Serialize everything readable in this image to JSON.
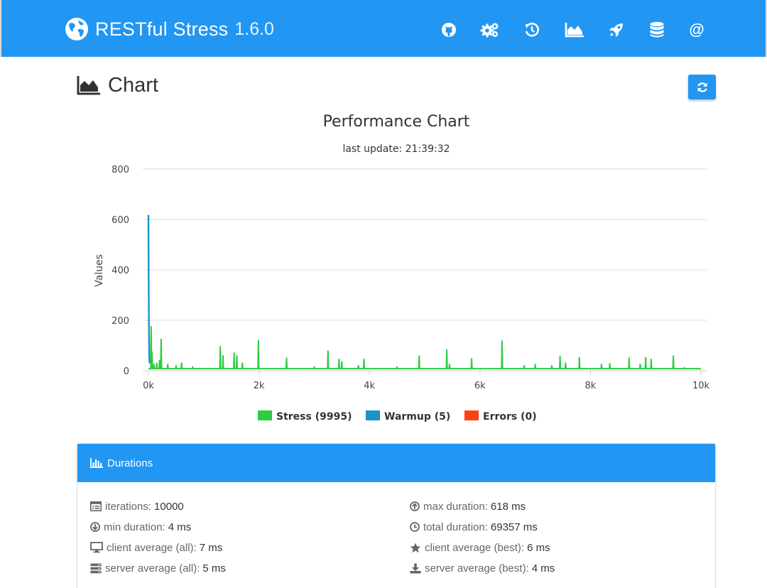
{
  "app": {
    "name": "RESTful Stress",
    "version": "1.6.0"
  },
  "nav": {
    "items": [
      {
        "name": "nav-github",
        "icon": "github-icon"
      },
      {
        "name": "nav-settings",
        "icon": "cogs-icon"
      },
      {
        "name": "nav-history",
        "icon": "history-icon"
      },
      {
        "name": "nav-chart",
        "icon": "area-chart-icon"
      },
      {
        "name": "nav-launch",
        "icon": "rocket-icon"
      },
      {
        "name": "nav-database",
        "icon": "database-icon"
      },
      {
        "name": "nav-contact",
        "icon": "at-icon",
        "text": "@"
      }
    ]
  },
  "page": {
    "title": "Chart",
    "refresh_icon": "refresh-icon"
  },
  "chart_data": {
    "type": "line",
    "title": "Performance Chart",
    "subtitle": "last update: 21:39:32",
    "ylabel": "Values",
    "xlabel": "",
    "xlim": [
      0,
      10000
    ],
    "ylim": [
      0,
      800
    ],
    "x_ticks": [
      "0k",
      "2k",
      "4k",
      "6k",
      "8k",
      "10k"
    ],
    "y_ticks": [
      "0",
      "200",
      "400",
      "600",
      "800"
    ],
    "grid": true,
    "legend_position": "bottom",
    "series": [
      {
        "name": "Stress (9995)",
        "color": "#2ecc40",
        "baseline": 8,
        "spikes": [
          {
            "x": 50,
            "y": 175
          },
          {
            "x": 65,
            "y": 75
          },
          {
            "x": 100,
            "y": 25
          },
          {
            "x": 150,
            "y": 30
          },
          {
            "x": 200,
            "y": 40
          },
          {
            "x": 230,
            "y": 125
          },
          {
            "x": 350,
            "y": 25
          },
          {
            "x": 500,
            "y": 20
          },
          {
            "x": 600,
            "y": 30
          },
          {
            "x": 800,
            "y": 15
          },
          {
            "x": 1300,
            "y": 95
          },
          {
            "x": 1350,
            "y": 60
          },
          {
            "x": 1550,
            "y": 70
          },
          {
            "x": 1600,
            "y": 60
          },
          {
            "x": 1700,
            "y": 30
          },
          {
            "x": 1990,
            "y": 120
          },
          {
            "x": 2500,
            "y": 50
          },
          {
            "x": 3000,
            "y": 15
          },
          {
            "x": 3250,
            "y": 78
          },
          {
            "x": 3450,
            "y": 45
          },
          {
            "x": 3500,
            "y": 35
          },
          {
            "x": 3800,
            "y": 20
          },
          {
            "x": 3900,
            "y": 45
          },
          {
            "x": 4500,
            "y": 15
          },
          {
            "x": 4900,
            "y": 58
          },
          {
            "x": 5400,
            "y": 82
          },
          {
            "x": 5450,
            "y": 25
          },
          {
            "x": 5850,
            "y": 47
          },
          {
            "x": 6400,
            "y": 118
          },
          {
            "x": 6800,
            "y": 20
          },
          {
            "x": 7000,
            "y": 25
          },
          {
            "x": 7300,
            "y": 20
          },
          {
            "x": 7450,
            "y": 57
          },
          {
            "x": 7550,
            "y": 30
          },
          {
            "x": 7800,
            "y": 52
          },
          {
            "x": 8200,
            "y": 25
          },
          {
            "x": 8350,
            "y": 28
          },
          {
            "x": 8700,
            "y": 50
          },
          {
            "x": 8900,
            "y": 25
          },
          {
            "x": 9000,
            "y": 52
          },
          {
            "x": 9100,
            "y": 45
          },
          {
            "x": 9500,
            "y": 58
          },
          {
            "x": 9700,
            "y": 12
          }
        ]
      },
      {
        "name": "Warmup (5)",
        "color": "#1a93c8",
        "points": [
          {
            "x": 0,
            "y": 618
          },
          {
            "x": 1,
            "y": 350
          },
          {
            "x": 2,
            "y": 150
          },
          {
            "x": 3,
            "y": 60
          },
          {
            "x": 4,
            "y": 30
          }
        ]
      },
      {
        "name": "Errors (0)",
        "color": "#ff4013",
        "points": []
      }
    ]
  },
  "durations": {
    "title": "Durations",
    "stats": [
      {
        "icon": "list-alt-icon",
        "label": "iterations:",
        "value": "10000"
      },
      {
        "icon": "arrow-circle-down-icon",
        "label": "min duration:",
        "value": "4 ms"
      },
      {
        "icon": "desktop-icon",
        "label": "client average (all):",
        "value": "7 ms"
      },
      {
        "icon": "server-icon",
        "label": "server average (all):",
        "value": "5 ms"
      },
      {
        "icon": "arrow-circle-up-icon",
        "label": "max duration:",
        "value": "618 ms"
      },
      {
        "icon": "clock-icon",
        "label": "total duration:",
        "value": "69357 ms"
      },
      {
        "icon": "star-icon",
        "label": "client average (best):",
        "value": "6 ms"
      },
      {
        "icon": "download-icon",
        "label": "server average (best):",
        "value": "4 ms"
      }
    ]
  }
}
